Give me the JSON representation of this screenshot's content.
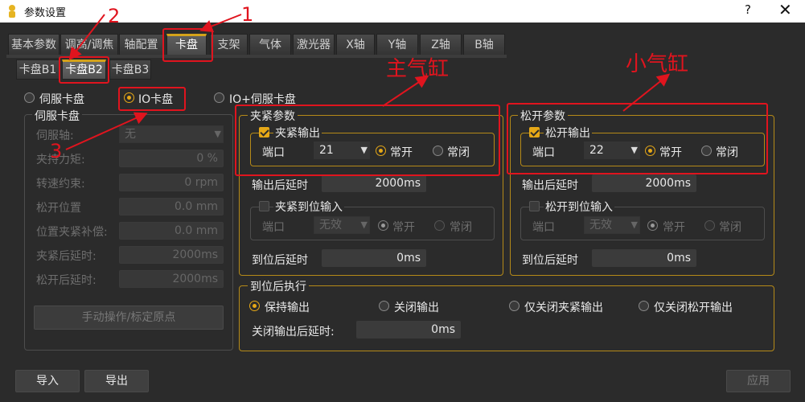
{
  "window": {
    "title": "参数设置",
    "help": "?",
    "close": "✕"
  },
  "tabs": [
    "基本参数",
    "调高/调焦",
    "轴配置",
    "卡盘",
    "支架",
    "气体",
    "激光器",
    "X轴",
    "Y轴",
    "Z轴",
    "B轴"
  ],
  "subtabs": [
    "卡盘B1",
    "卡盘B2",
    "卡盘B3"
  ],
  "mode": {
    "servo": "伺服卡盘",
    "io": "IO卡盘",
    "io_servo": "IO+伺服卡盘"
  },
  "servo_group": {
    "title": "伺服卡盘",
    "rows": [
      {
        "label": "伺服轴:",
        "value": "无"
      },
      {
        "label": "夹持力矩:",
        "value": "0 %"
      },
      {
        "label": "转速约束:",
        "value": "0 rpm"
      },
      {
        "label": "松开位置",
        "value": "0.0 mm"
      },
      {
        "label": "位置夹紧补偿:",
        "value": "0.0 mm"
      },
      {
        "label": "夹紧后延时:",
        "value": "2000ms"
      },
      {
        "label": "松开后延时:",
        "value": "2000ms"
      }
    ],
    "manual_button": "手动操作/标定原点"
  },
  "clamp": {
    "title": "夹紧参数",
    "output_title": "夹紧输出",
    "port_label": "端口",
    "port": "21",
    "no": "常开",
    "nc": "常闭",
    "delay_label": "输出后延时",
    "delay": "2000ms",
    "input_title": "夹紧到位输入",
    "input_port": "无效",
    "arrive_label": "到位后延时",
    "arrive_delay": "0ms"
  },
  "release": {
    "title": "松开参数",
    "output_title": "松开输出",
    "port_label": "端口",
    "port": "22",
    "no": "常开",
    "nc": "常闭",
    "delay_label": "输出后延时",
    "delay": "2000ms",
    "input_title": "松开到位输入",
    "input_port": "无效",
    "arrive_label": "到位后延时",
    "arrive_delay": "0ms"
  },
  "after": {
    "title": "到位后执行",
    "options": [
      "保持输出",
      "关闭输出",
      "仅关闭夹紧输出",
      "仅关闭松开输出"
    ],
    "close_delay_label": "关闭输出后延时:",
    "close_delay": "0ms"
  },
  "footer": {
    "import": "导入",
    "export": "导出",
    "apply": "应用"
  },
  "annotations": {
    "n1": "1",
    "n2": "2",
    "n3": "3",
    "main_cyl": "主气缸",
    "small_cyl": "小气缸"
  },
  "colors": {
    "accent": "#e6a817",
    "annotation": "#e0141e",
    "background": "#2b2b2b"
  }
}
